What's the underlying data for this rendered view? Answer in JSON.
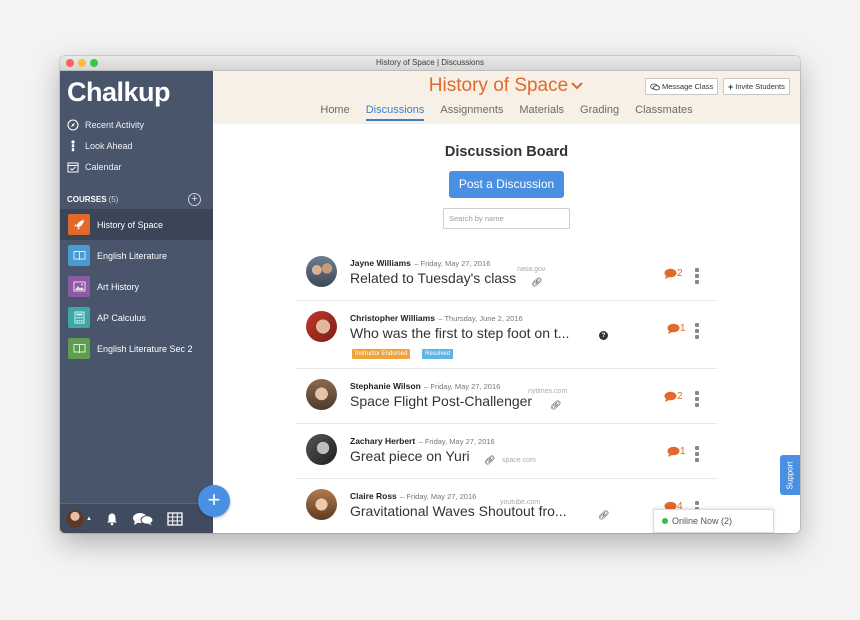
{
  "window": {
    "title": "History of Space | Discussions"
  },
  "sidebar": {
    "logo": "Chalkup",
    "nav": [
      {
        "label": "Recent Activity",
        "icon": "compass-icon"
      },
      {
        "label": "Look Ahead",
        "icon": "look-ahead-icon"
      },
      {
        "label": "Calendar",
        "icon": "calendar-icon"
      }
    ],
    "courses_label": "COURSES",
    "courses_count": "(5)",
    "courses": [
      {
        "label": "History of Space",
        "icon": "rocket-icon",
        "color": "#e0692b",
        "active": true
      },
      {
        "label": "English Literature",
        "icon": "book-icon",
        "color": "#4a9ad4",
        "active": false
      },
      {
        "label": "Art History",
        "icon": "picture-icon",
        "color": "#8e5aa6",
        "active": false
      },
      {
        "label": "AP Calculus",
        "icon": "calculator-icon",
        "color": "#3fa6a6",
        "active": false
      },
      {
        "label": "English Literature Sec 2",
        "icon": "book-icon",
        "color": "#5e9c52",
        "active": false
      }
    ]
  },
  "header": {
    "course_title": "History of Space",
    "message_class": "Message Class",
    "invite_students": "Invite Students",
    "tabs": [
      "Home",
      "Discussions",
      "Assignments",
      "Materials",
      "Grading",
      "Classmates"
    ],
    "active_tab": "Discussions"
  },
  "board": {
    "title": "Discussion Board",
    "post_button": "Post a Discussion",
    "search_placeholder": "Search by name",
    "discussions": [
      {
        "author": "Jayne Williams",
        "date": "– Friday, May 27, 2016",
        "title": "Related to Tuesday's class",
        "domain": "nasa.gov",
        "has_link": true,
        "has_question": false,
        "badges": [],
        "comments": "2"
      },
      {
        "author": "Christopher Williams",
        "date": "– Thursday, June 2, 2016",
        "title": "Who was the first to step foot on t...",
        "domain": "",
        "has_link": false,
        "has_question": true,
        "badges": [
          {
            "label": "Instructor Endorsed",
            "color": "#f0a23c"
          },
          {
            "label": "Resolved",
            "color": "#5bb6e6"
          }
        ],
        "comments": "1"
      },
      {
        "author": "Stephanie Wilson",
        "date": "– Friday, May 27, 2016",
        "title": "Space Flight Post-Challenger",
        "domain": "nytimes.com",
        "has_link": true,
        "has_question": false,
        "badges": [],
        "comments": "2"
      },
      {
        "author": "Zachary Herbert",
        "date": "– Friday, May 27, 2016",
        "title": "Great piece on Yuri",
        "domain": "space.com",
        "has_link": true,
        "has_question": false,
        "badges": [],
        "comments": "1"
      },
      {
        "author": "Claire Ross",
        "date": "– Friday, May 27, 2016",
        "title": "Gravitational Waves Shoutout fro...",
        "domain": "youtube.com",
        "has_link": true,
        "has_question": false,
        "badges": [],
        "comments": "4"
      }
    ]
  },
  "online_now": "Online Now (2)",
  "support": "Support",
  "colors": {
    "accent": "#e0692b",
    "primary": "#4a90e2",
    "sidebar": "#48556b"
  }
}
